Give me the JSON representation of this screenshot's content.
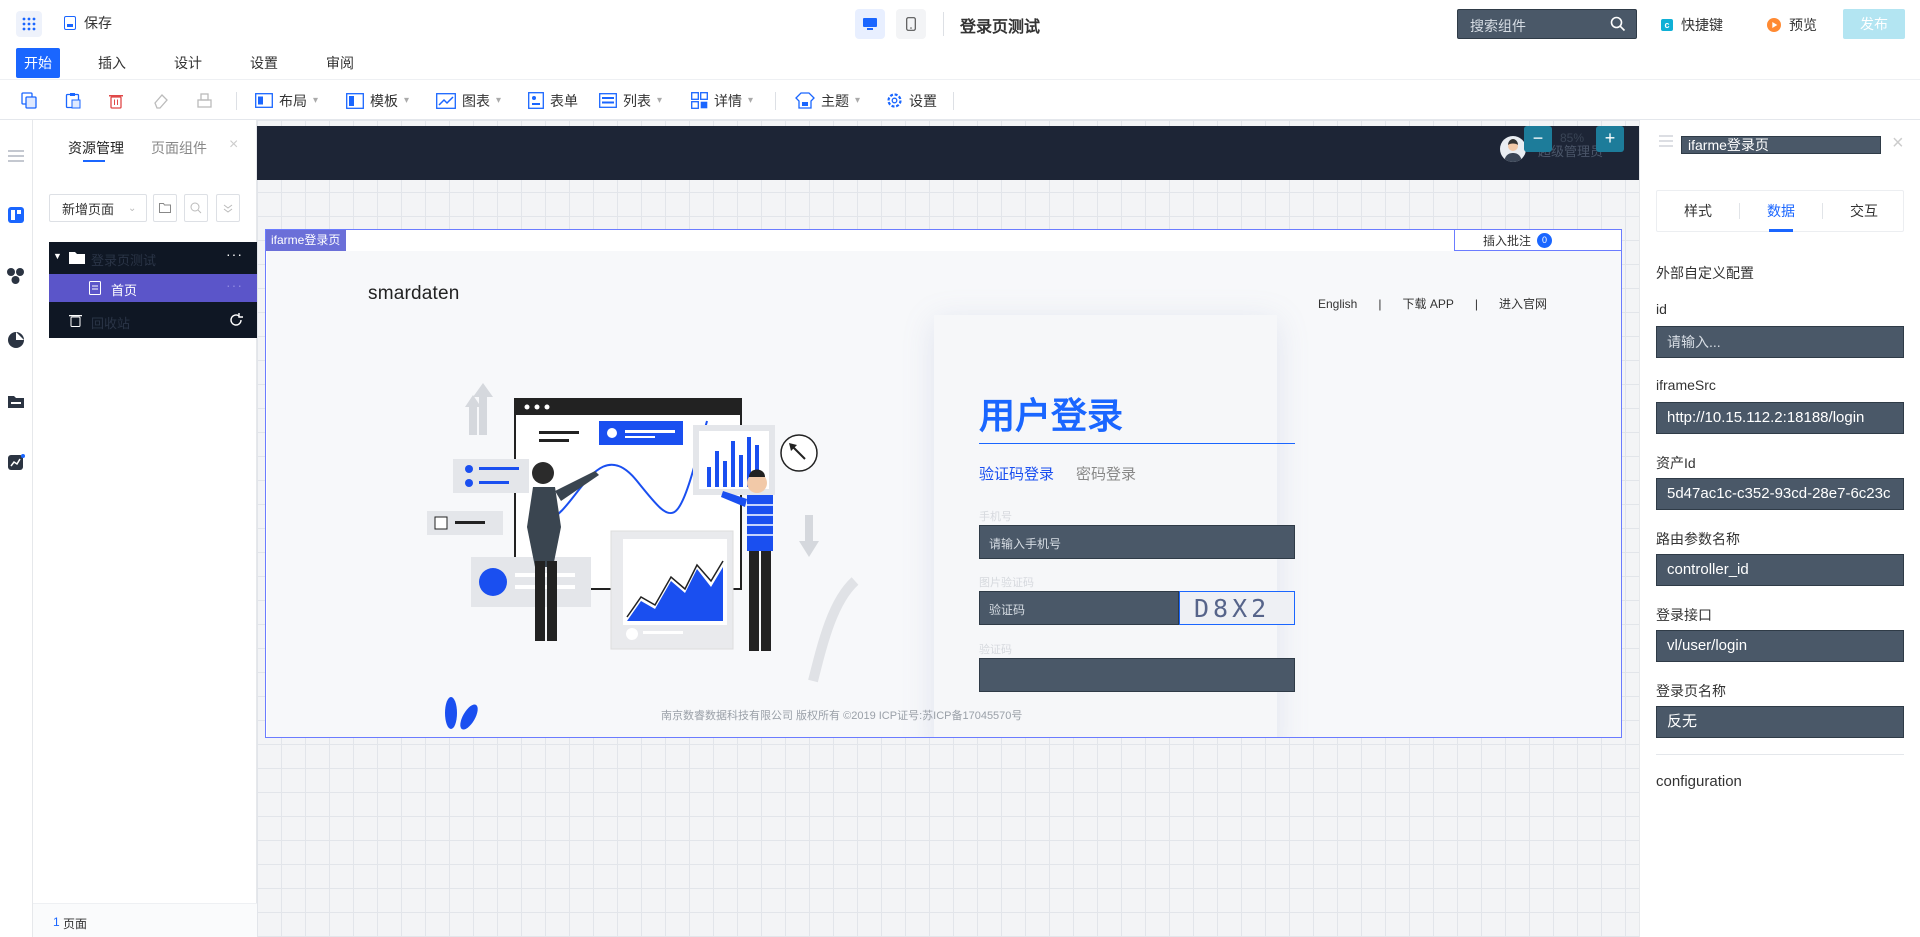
{
  "header": {
    "save_label": "保存",
    "page_title": "登录页测试",
    "search_placeholder": "搜索组件",
    "shortcut_label": "快捷键",
    "preview_label": "预览",
    "publish_label": "发布"
  },
  "menu": {
    "tabs": [
      {
        "label": "开始"
      },
      {
        "label": "插入"
      },
      {
        "label": "设计"
      },
      {
        "label": "设置"
      },
      {
        "label": "审阅"
      }
    ]
  },
  "toolbar": {
    "items": [
      {
        "label": "布局",
        "icon": "layout-icon"
      },
      {
        "label": "模板",
        "icon": "template-icon"
      },
      {
        "label": "图表",
        "icon": "chart-icon"
      },
      {
        "label": "表单",
        "icon": "form-icon"
      },
      {
        "label": "列表",
        "icon": "list-icon"
      },
      {
        "label": "详情",
        "icon": "detail-icon"
      },
      {
        "label": "主题",
        "icon": "theme-icon"
      },
      {
        "label": "设置",
        "icon": "settings-icon"
      }
    ]
  },
  "left_panel": {
    "tabs": [
      "资源管理",
      "页面组件"
    ],
    "new_page_label": "新增页面",
    "tree": {
      "folder_label": "登录页测试",
      "page_label": "首页",
      "recycle_label": "回收站"
    },
    "footer_count": "1",
    "footer_label": "页面"
  },
  "canvas": {
    "zoom": "85%",
    "user_label": "超级管理员",
    "component_tag": "ifarme登录页",
    "annotation_label": "插入批注",
    "annotation_count": "0",
    "login": {
      "logo": "smardaten",
      "nav": [
        "English",
        "下载 APP",
        "进入官网"
      ],
      "title": "用户登录",
      "tab_active": "验证码登录",
      "tab_inactive": "密码登录",
      "phone_label": "手机号",
      "phone_placeholder": "请输入手机号",
      "code_label": "图片验证码",
      "code_placeholder": "验证码",
      "captcha": "D8X2",
      "sms_label": "验证码",
      "footer": "南京数睿数据科技有限公司 版权所有 ©2019 ICP证号:苏ICP备17045570号"
    }
  },
  "right_panel": {
    "title": "ifarme登录页",
    "tabs": [
      "样式",
      "数据",
      "交互"
    ],
    "active_tab": "数据",
    "section": "外部自定义配置",
    "fields": [
      {
        "label": "id",
        "value": "",
        "placeholder": "请输入..."
      },
      {
        "label": "iframeSrc",
        "value": "http://10.15.112.2:18188/login"
      },
      {
        "label": "资产Id",
        "value": "5d47ac1c-c352-93cd-28e7-6c23c"
      },
      {
        "label": "路由参数名称",
        "value": "controller_id"
      },
      {
        "label": "登录接口",
        "value": "vl/user/login"
      },
      {
        "label": "登录页名称",
        "value": "反无"
      }
    ],
    "configuration_label": "configuration"
  },
  "colors": {
    "primary": "#1a66ff",
    "dark_header": "#1d2536",
    "field_bg": "#4a5868",
    "tree_bg": "#0f1724",
    "tree_selected": "#5b55c9",
    "publish_bg": "#b3e5f2"
  }
}
